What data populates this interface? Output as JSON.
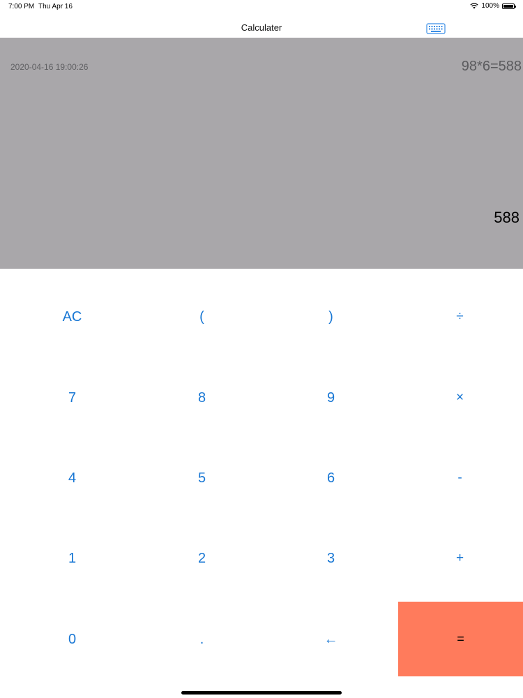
{
  "status_bar": {
    "time": "7:00 PM",
    "date": "Thu Apr 16",
    "battery": "100%",
    "icons": [
      "wifi-icon",
      "battery-icon"
    ]
  },
  "nav": {
    "title": "Calculater",
    "keyboard_icon": "keyboard-icon"
  },
  "display": {
    "history_date": "2020-04-16 19:00:26",
    "history_expression": "98*6=588",
    "result": "588",
    "background": "#a9a7aa"
  },
  "keypad": {
    "rows": [
      [
        "AC",
        "(",
        ")",
        "÷"
      ],
      [
        "7",
        "8",
        "9",
        "×"
      ],
      [
        "4",
        "5",
        "6",
        "-"
      ],
      [
        "1",
        "2",
        "3",
        "+"
      ],
      [
        "0",
        ".",
        "←",
        "="
      ]
    ],
    "key_color": "#1877d4",
    "equals_background": "#ff7b5c"
  }
}
